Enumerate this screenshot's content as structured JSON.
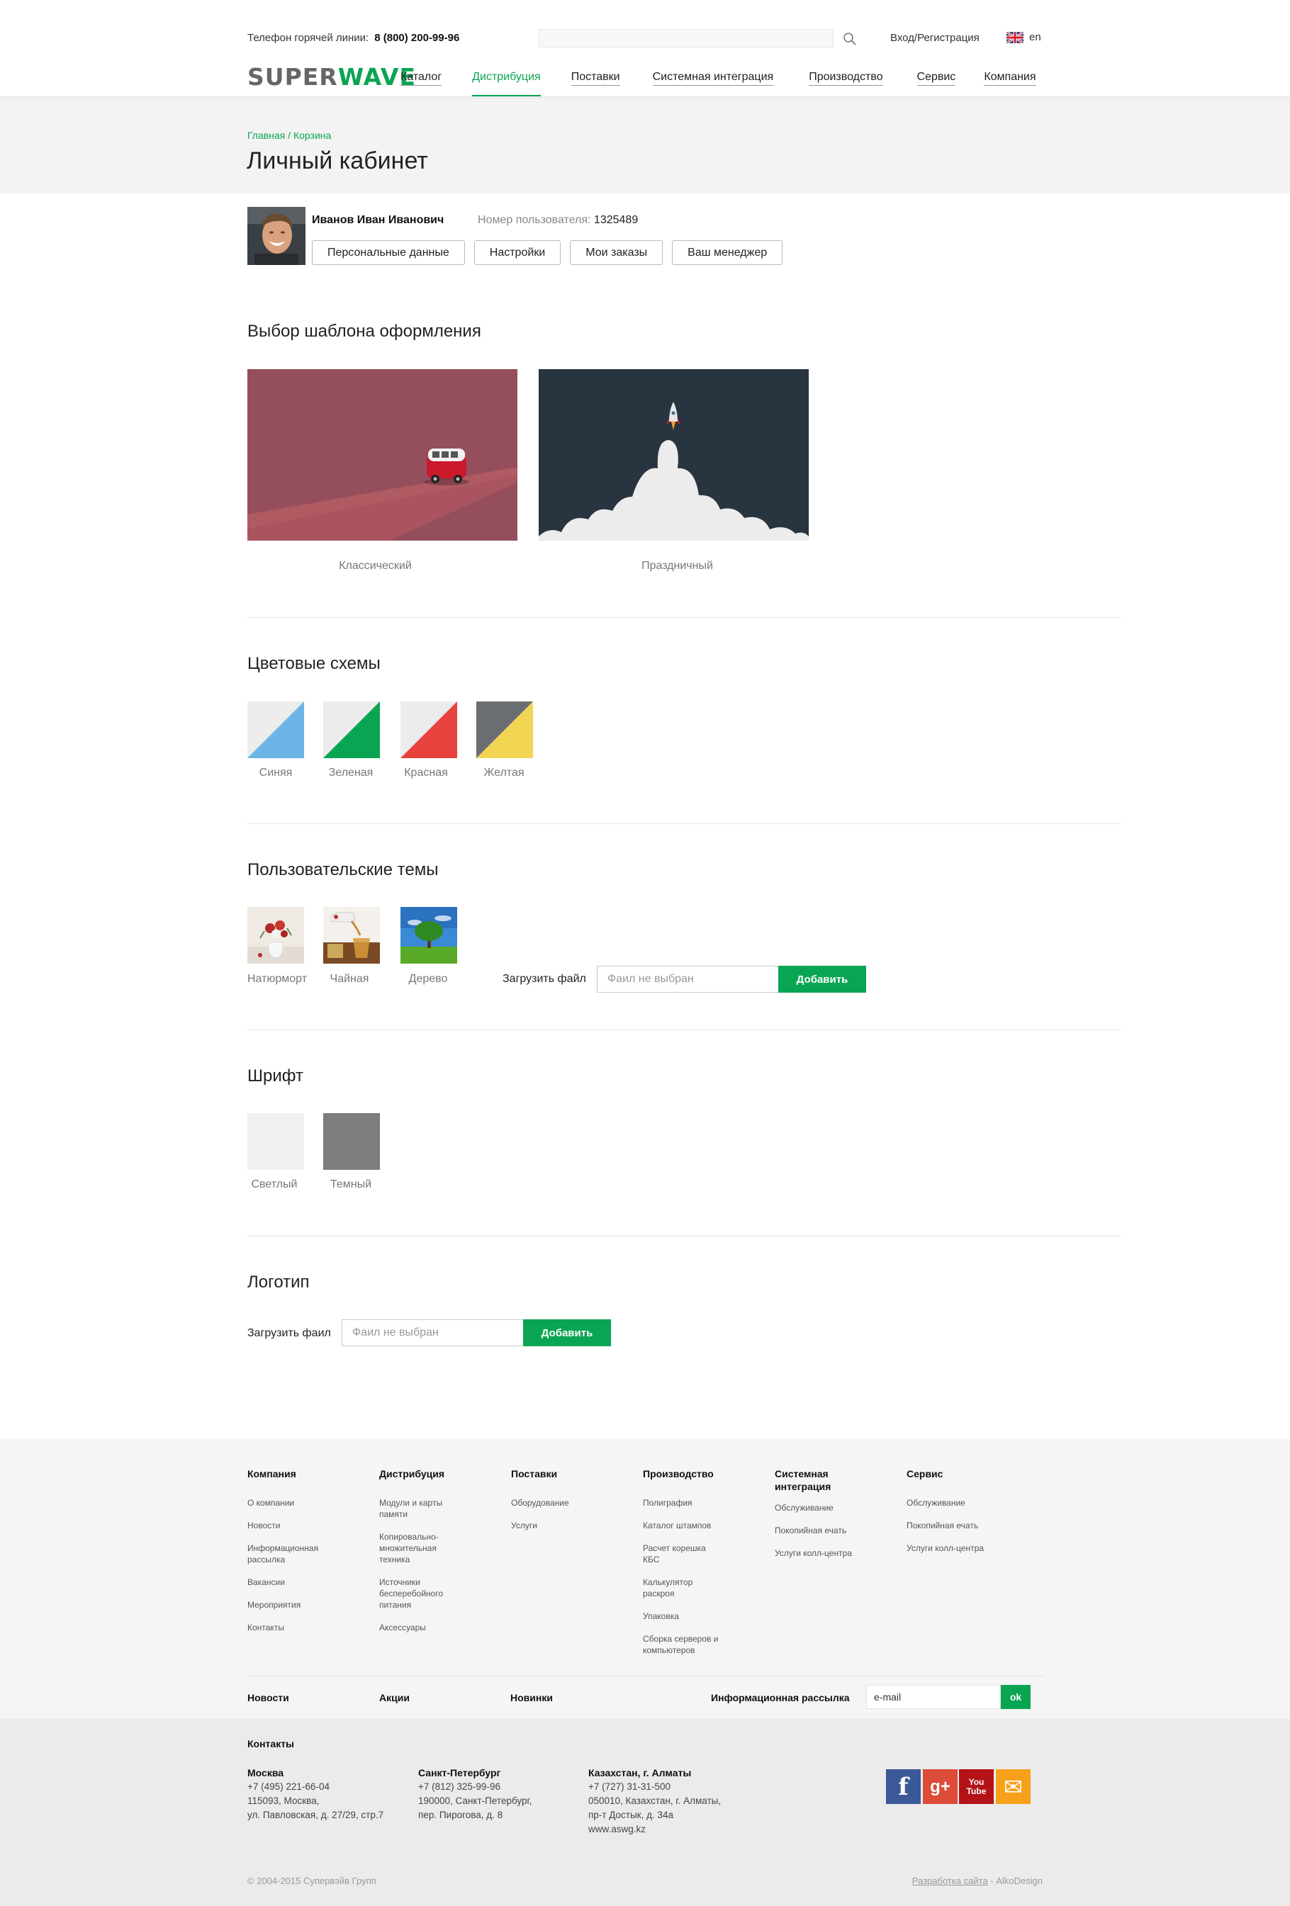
{
  "header": {
    "hotline_label": "Телефон горячей линии:",
    "hotline_phone": "8 (800) 200-99-96",
    "login": "Вход/Регистрация",
    "lang": "en",
    "logo_a": "SUPER",
    "logo_b": "WAVE",
    "nav": [
      "Каталог",
      "Дистрибуция",
      "Поставки",
      "Системная интеграция",
      "Производство",
      "Сервис",
      "Компания"
    ],
    "nav_active": "Дистрибуция"
  },
  "breadcrumb": "Главная / Корзина",
  "page_title": "Личный кабинет",
  "user": {
    "name": "Иванов Иван Иванович",
    "number_label": "Номер пользователя:",
    "number": "1325489",
    "buttons": [
      "Персональные данные",
      "Настройки",
      "Мои заказы",
      "Ваш менеджер"
    ]
  },
  "templates": {
    "title": "Выбор шаблона оформления",
    "items": [
      "Классический",
      "Праздничный"
    ]
  },
  "colors": {
    "title": "Цветовые схемы",
    "items": [
      {
        "label": "Синяя",
        "color": "#6cb4e6"
      },
      {
        "label": "Зеленая",
        "color": "#0aa552"
      },
      {
        "label": "Красная",
        "color": "#e8423f"
      },
      {
        "label": "Желтая",
        "color": "#f2d552"
      }
    ]
  },
  "themes": {
    "title": "Пользовательские темы",
    "items": [
      "Натюрморт",
      "Чайная",
      "Дерево"
    ],
    "upload_label": "Загрузить файл",
    "file_placeholder": "Фаил не выбран",
    "add_label": "Добавить"
  },
  "font": {
    "title": "Шрифт",
    "items": [
      "Светлый",
      "Темный"
    ]
  },
  "logo_section": {
    "title": "Логотип",
    "upload_label": "Загрузить фаил",
    "file_placeholder": "Фаил не выбран",
    "add_label": "Добавить"
  },
  "footer": {
    "columns": [
      {
        "title": "Компания",
        "items": [
          "О компании",
          "Новости",
          "Информационная рассылка",
          "Вакансии",
          "Мероприятия",
          "Контакты"
        ]
      },
      {
        "title": "Дистрибуция",
        "items": [
          "Модули и карты памяти",
          "Копировально-множительная техника",
          "Источники бесперебойного питания",
          "Аксессуары"
        ]
      },
      {
        "title": "Поставки",
        "items": [
          "Оборудование",
          "Услуги"
        ]
      },
      {
        "title": "Производство",
        "items": [
          "Полиграфия",
          "Каталог штампов",
          "Расчет корешка КБС",
          "Калькулятор раскроя",
          "Упаковка",
          "Сборка серверов и компьютеров"
        ]
      },
      {
        "title": "Системная интеграция",
        "items": [
          "Обслуживание",
          "Покопийная ечать",
          "Услуги колл-центра"
        ]
      },
      {
        "title": "Сервис",
        "items": [
          "Обслуживание",
          "Покопийная ечать",
          "Услуги колл-центра"
        ]
      }
    ],
    "bottom_links": [
      "Новости",
      "Акции",
      "Новинки"
    ],
    "newsletter_label": "Информационная рассылка",
    "email_value": "e-mail",
    "ok_label": "ok",
    "contacts_title": "Контакты",
    "offices": [
      {
        "city": "Москва",
        "lines": [
          "+7 (495) 221-66-04",
          "115093, Москва,",
          "ул. Павловская, д. 27/29, стр.7"
        ]
      },
      {
        "city": "Санкт-Петербург",
        "lines": [
          "+7 (812) 325-99-96",
          "190000, Санкт-Петербург,",
          "пер. Пирогова, д. 8"
        ]
      },
      {
        "city": "Казахстан, г. Алматы",
        "lines": [
          "+7 (727) 31-31-500",
          "050010, Казахстан, г. Алматы,",
          "пр-т Достык, д. 34а",
          "www.aswg.kz"
        ]
      }
    ],
    "social": [
      {
        "icon": "facebook-icon",
        "glyph": "f",
        "color": "#3b5998"
      },
      {
        "icon": "google-plus-icon",
        "glyph": "g+",
        "color": "#dd4b39"
      },
      {
        "icon": "youtube-icon",
        "glyph": "You Tube",
        "color": "#b31217"
      },
      {
        "icon": "mail-icon",
        "glyph": "✉",
        "color": "#f7a11a"
      }
    ],
    "copyright": "© 2004-2015 Супервэйв Групп",
    "dev_link": "Разработка сайта",
    "dev_name": " - AlkoDesign"
  }
}
